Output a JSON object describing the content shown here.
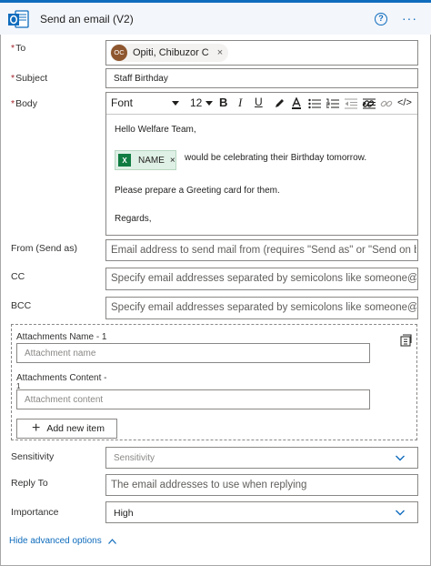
{
  "header": {
    "title": "Send an email (V2)",
    "help_glyph": "?",
    "more_glyph": "···",
    "colors": {
      "brand": "#0f6cbd"
    }
  },
  "to": {
    "label": "To",
    "required_marker": "*",
    "token": {
      "initials": "OC",
      "name": "Opiti, Chibuzor C",
      "remove_glyph": "×",
      "avatar_color": "#8e562e"
    }
  },
  "subject": {
    "label": "Subject",
    "required_marker": "*",
    "value": "Staff Birthday"
  },
  "body": {
    "label": "Body",
    "required_marker": "*",
    "toolbar": {
      "font_value": "Font",
      "size_value": "12",
      "bold": "B",
      "italic": "I",
      "underline": "U",
      "code": "</>"
    },
    "lines": {
      "greeting": "Hello Welfare Team,",
      "after_chip": "would be celebrating their Birthday tomorrow.",
      "request": "Please prepare a Greeting card for them.",
      "closing": "Regards,"
    },
    "chip": {
      "label": "NAME",
      "remove_glyph": "×",
      "icon": "excel-icon",
      "color": "#107c41"
    }
  },
  "from": {
    "label": "From (Send as)",
    "placeholder": "Email address to send mail from (requires \"Send as\" or \"Send on b"
  },
  "cc": {
    "label": "CC",
    "placeholder": "Specify email addresses separated by semicolons like someone@c"
  },
  "bcc": {
    "label": "BCC",
    "placeholder": "Specify email addresses separated by semicolons like someone@c"
  },
  "attachments": {
    "name_label": "Attachments Name - 1",
    "name_placeholder": "Attachment name",
    "content_label": "Attachments Content -",
    "content_label_line2": "1",
    "content_placeholder": "Attachment content",
    "add_label": "Add new item",
    "add_glyph": "+"
  },
  "sensitivity": {
    "label": "Sensitivity",
    "placeholder": "Sensitivity"
  },
  "reply_to": {
    "label": "Reply To",
    "placeholder": "The email addresses to use when replying"
  },
  "importance": {
    "label": "Importance",
    "value": "High"
  },
  "footer": {
    "toggle_label": "Hide advanced options"
  }
}
